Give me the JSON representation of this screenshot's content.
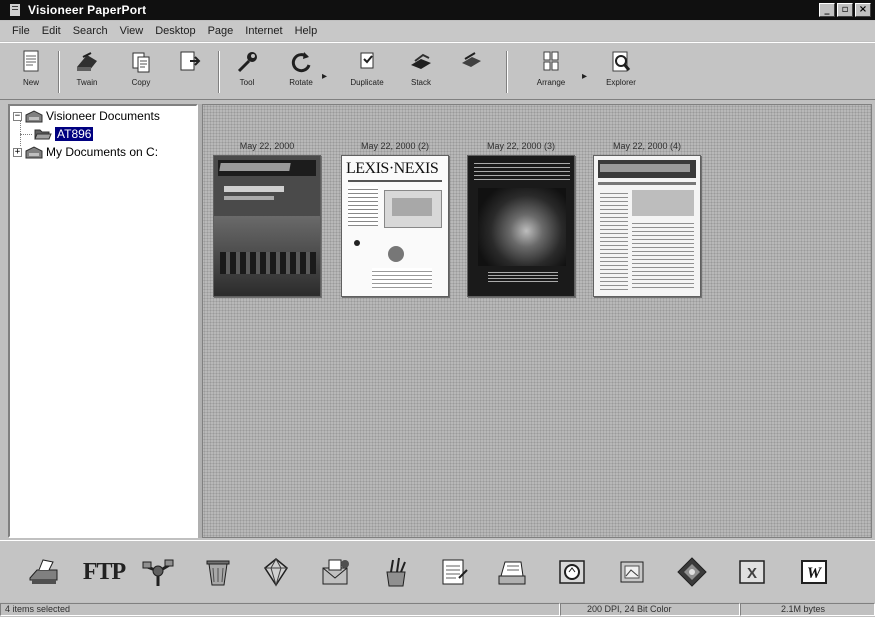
{
  "window": {
    "title": "Visioneer PaperPort"
  },
  "menu": [
    "File",
    "Edit",
    "Search",
    "View",
    "Desktop",
    "Page",
    "Internet",
    "Help"
  ],
  "toolbar": {
    "buttons": [
      {
        "label": "New",
        "icon": "new-page-icon"
      },
      {
        "label": "Twain",
        "icon": "scanner-icon"
      },
      {
        "label": "Copy",
        "icon": "copy-icon"
      },
      {
        "label": "",
        "icon": "import-icon"
      },
      {
        "label": "Tool",
        "icon": "tool-icon"
      },
      {
        "label": "Rotate",
        "icon": "rotate-icon"
      },
      {
        "label": "Duplicate",
        "icon": "duplicate-icon"
      },
      {
        "label": "Stack",
        "icon": "stack-icon"
      },
      {
        "label": "",
        "icon": "unstack-icon"
      },
      {
        "label": "Arrange",
        "icon": "arrange-icon"
      },
      {
        "label": "Explorer",
        "icon": "explorer-icon"
      }
    ]
  },
  "tree": {
    "root": "Visioneer Documents",
    "selected_folder": "AT896",
    "second_root": "My Documents on C:"
  },
  "documents": [
    {
      "label": "May 22, 2000",
      "cover": "magazine-color"
    },
    {
      "label": "May 22, 2000 (2)",
      "cover": "lexisnexis",
      "masthead": "LEXIS·NEXIS"
    },
    {
      "label": "May 22, 2000 (3)",
      "cover": "dark-brochure"
    },
    {
      "label": "May 22, 2000 (4)",
      "cover": "magazine-text"
    }
  ],
  "sendto": [
    {
      "icon": "scanner-printer-icon"
    },
    {
      "icon": "ftp-icon",
      "label": "FTP"
    },
    {
      "icon": "network-icon"
    },
    {
      "icon": "recycle-icon"
    },
    {
      "icon": "gem-icon"
    },
    {
      "icon": "email-icon"
    },
    {
      "icon": "paint-icon"
    },
    {
      "icon": "notepad-icon"
    },
    {
      "icon": "fax-icon"
    },
    {
      "icon": "ocr-icon"
    },
    {
      "icon": "image-viewer-icon"
    },
    {
      "icon": "photo-editor-icon"
    },
    {
      "icon": "excel-icon",
      "label": "X"
    },
    {
      "icon": "word-icon",
      "label": "W"
    }
  ],
  "status": {
    "selection": "4 items selected",
    "dpi": "200 DPI, 24 Bit Color",
    "size": "2.1M bytes"
  },
  "colors": {
    "titlebar": "#101010",
    "selection": "#000080",
    "desktop": "#b8b8b8"
  }
}
